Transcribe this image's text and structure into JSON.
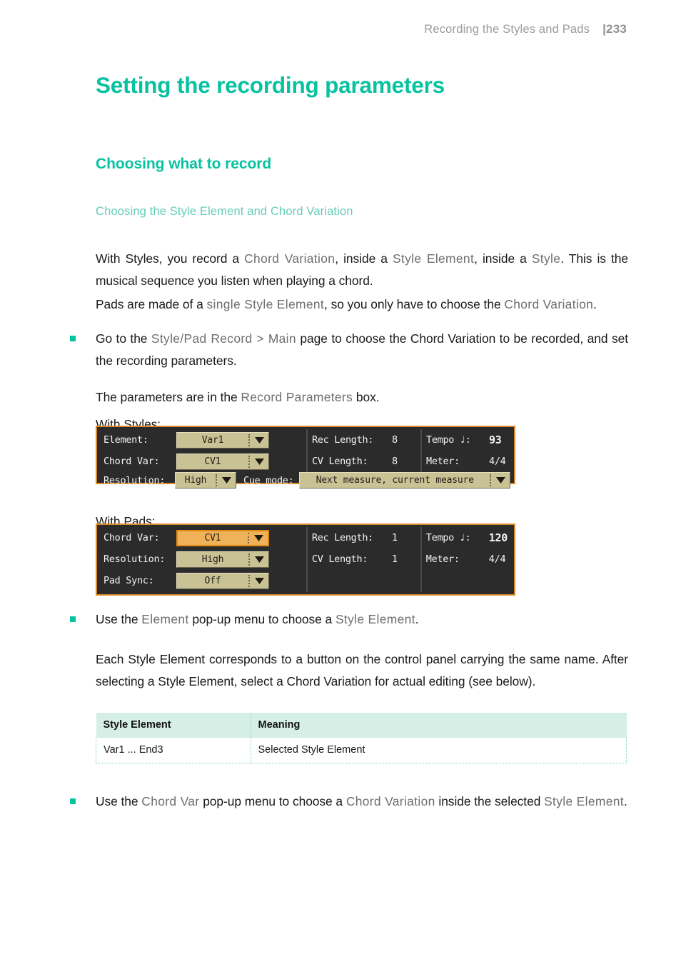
{
  "header": {
    "title": "Recording the Styles and Pads",
    "folio": "|233"
  },
  "doc": {
    "title": "Setting the recording parameters",
    "section": "Choosing what to record",
    "subsection": "Choosing the Style Element and Chord Variation"
  },
  "paragraphs": {
    "p1_a": "With Styles, you record a ",
    "p1_t1": "Chord Variation",
    "p1_b": ", inside a ",
    "p1_t2": "Style Element",
    "p1_c": ", inside a ",
    "p1_t3": "Style",
    "p1_d": ". This is the musical sequence you listen when playing a chord.",
    "p2_a": "Pads are made of a ",
    "p2_t1": "single Style Element",
    "p2_b": ", so you only have to choose the ",
    "p2_t2": "Chord Variation",
    "p2_c": ".",
    "b1_a": "Go to the ",
    "b1_t1": "Style/Pad Record > Main",
    "b1_b": " page to choose the Chord Variation to be recorded, and set the recording parameters.",
    "p3_a": "The parameters are in the ",
    "p3_t1": "Record Parameters",
    "p3_b": " box.",
    "caption_styles": "With Styles:",
    "caption_pads": "With Pads:",
    "b2_a": "Use the ",
    "b2_t1": "Element",
    "b2_b": " pop-up menu to choose a ",
    "b2_t2": "Style Element",
    "b2_c": ".",
    "p4": "Each Style Element corresponds to a button on the control panel carrying the same name. After selecting a Style Element, select a Chord Variation for actual editing (see below).",
    "b3_a": "Use the ",
    "b3_t1": "Chord Var",
    "b3_b": " pop-up menu to choose a ",
    "b3_t2": "Chord Variation",
    "b3_c": " inside the selected ",
    "b3_t3": "Style Element",
    "b3_d": "."
  },
  "lcd_styles": {
    "element_label": "Element:",
    "element_value": "Var1",
    "chordvar_label": "Chord Var:",
    "chordvar_value": "CV1",
    "resolution_label": "Resolution:",
    "resolution_value": "High",
    "reclength_label": "Rec Length:",
    "reclength_value": "8",
    "cvlength_label": "CV Length:",
    "cvlength_value": "8",
    "tempo_label": "Tempo  ♩:",
    "tempo_value": "93",
    "meter_label": "Meter:",
    "meter_value": "4/4",
    "cuemode_label": "Cue mode:",
    "cuemode_value": "Next measure, current measure"
  },
  "lcd_pads": {
    "chordvar_label": "Chord Var:",
    "chordvar_value": "CV1",
    "resolution_label": "Resolution:",
    "resolution_value": "High",
    "padsync_label": "Pad Sync:",
    "padsync_value": "Off",
    "reclength_label": "Rec Length:",
    "reclength_value": "1",
    "cvlength_label": "CV Length:",
    "cvlength_value": "1",
    "tempo_label": "Tempo  ♩:",
    "tempo_value": "120",
    "meter_label": "Meter:",
    "meter_value": "4/4"
  },
  "table": {
    "headers": [
      "Style Element",
      "Meaning"
    ],
    "rows": [
      [
        "Var1 ... End3",
        "Selected Style Element"
      ]
    ]
  },
  "colors": {
    "accent": "#07C2A0",
    "accent_light": "#64CEB6",
    "term_gray": "#6e6e6e",
    "lcd_bg": "#2b2b2b",
    "lcd_border": "#D98A2B",
    "dropdown_fill": "#C8C295",
    "dropdown_selected": "#F0B259",
    "table_header_bg": "#D6EFE6"
  }
}
